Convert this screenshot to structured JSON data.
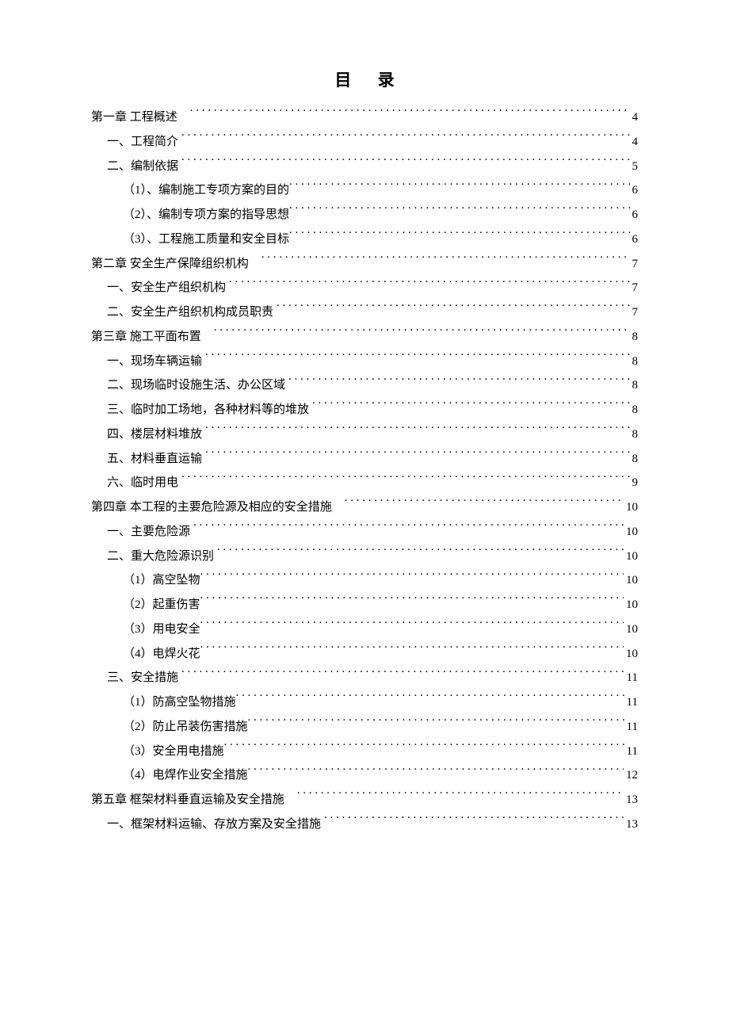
{
  "title": "目 录",
  "toc": [
    {
      "level": 0,
      "label": "第一章  工程概述",
      "page": "4"
    },
    {
      "level": 1,
      "label": "一、工程简介",
      "page": "4"
    },
    {
      "level": 1,
      "label": "二、编制依据",
      "page": "5"
    },
    {
      "level": 2,
      "label": "（1）、编制施工专项方案的目的",
      "page": "6"
    },
    {
      "level": 2,
      "label": "（2）、编制专项方案的指导思想",
      "page": "6"
    },
    {
      "level": 2,
      "label": "（3）、工程施工质量和安全目标",
      "page": "6"
    },
    {
      "level": 0,
      "label": "第二章  安全生产保障组织机构",
      "page": "7"
    },
    {
      "level": 1,
      "label": "一、安全生产组织机构",
      "page": "7"
    },
    {
      "level": 1,
      "label": "二、安全生产组织机构成员职责",
      "page": "7"
    },
    {
      "level": 0,
      "label": "第三章  施工平面布置",
      "page": "8"
    },
    {
      "level": 1,
      "label": "一、现场车辆运输",
      "page": "8"
    },
    {
      "level": 1,
      "label": "二、现场临时设施生活、办公区域",
      "page": "8"
    },
    {
      "level": 1,
      "label": "三、临时加工场地，各种材料等的堆放",
      "page": "8"
    },
    {
      "level": 1,
      "label": "四、楼层材料堆放",
      "page": "8"
    },
    {
      "level": 1,
      "label": "五、材料垂直运输",
      "page": "8"
    },
    {
      "level": 1,
      "label": "六、临时用电",
      "page": "9"
    },
    {
      "level": 0,
      "label": "第四章  本工程的主要危险源及相应的安全措施",
      "page": "10"
    },
    {
      "level": 1,
      "label": "一、主要危险源",
      "page": "10"
    },
    {
      "level": 1,
      "label": "二、重大危险源识别",
      "page": "10"
    },
    {
      "level": 2,
      "label": "（1）高空坠物",
      "page": "10"
    },
    {
      "level": 2,
      "label": "（2）起重伤害",
      "page": "10"
    },
    {
      "level": 2,
      "label": "（3）用电安全",
      "page": "10"
    },
    {
      "level": 2,
      "label": "（4）电焊火花",
      "page": "10"
    },
    {
      "level": 1,
      "label": "三、安全措施",
      "page": "11"
    },
    {
      "level": 2,
      "label": "（1）防高空坠物措施",
      "page": "11"
    },
    {
      "level": 2,
      "label": "（2）防止吊装伤害措施",
      "page": "11"
    },
    {
      "level": 2,
      "label": "（3）安全用电措施",
      "page": "11"
    },
    {
      "level": 2,
      "label": "（4）电焊作业安全措施",
      "page": "12"
    },
    {
      "level": 0,
      "label": "第五章  框架材料垂直运输及安全措施",
      "page": "13"
    },
    {
      "level": 1,
      "label": "一、框架材料运输、存放方案及安全措施",
      "page": "13"
    }
  ]
}
